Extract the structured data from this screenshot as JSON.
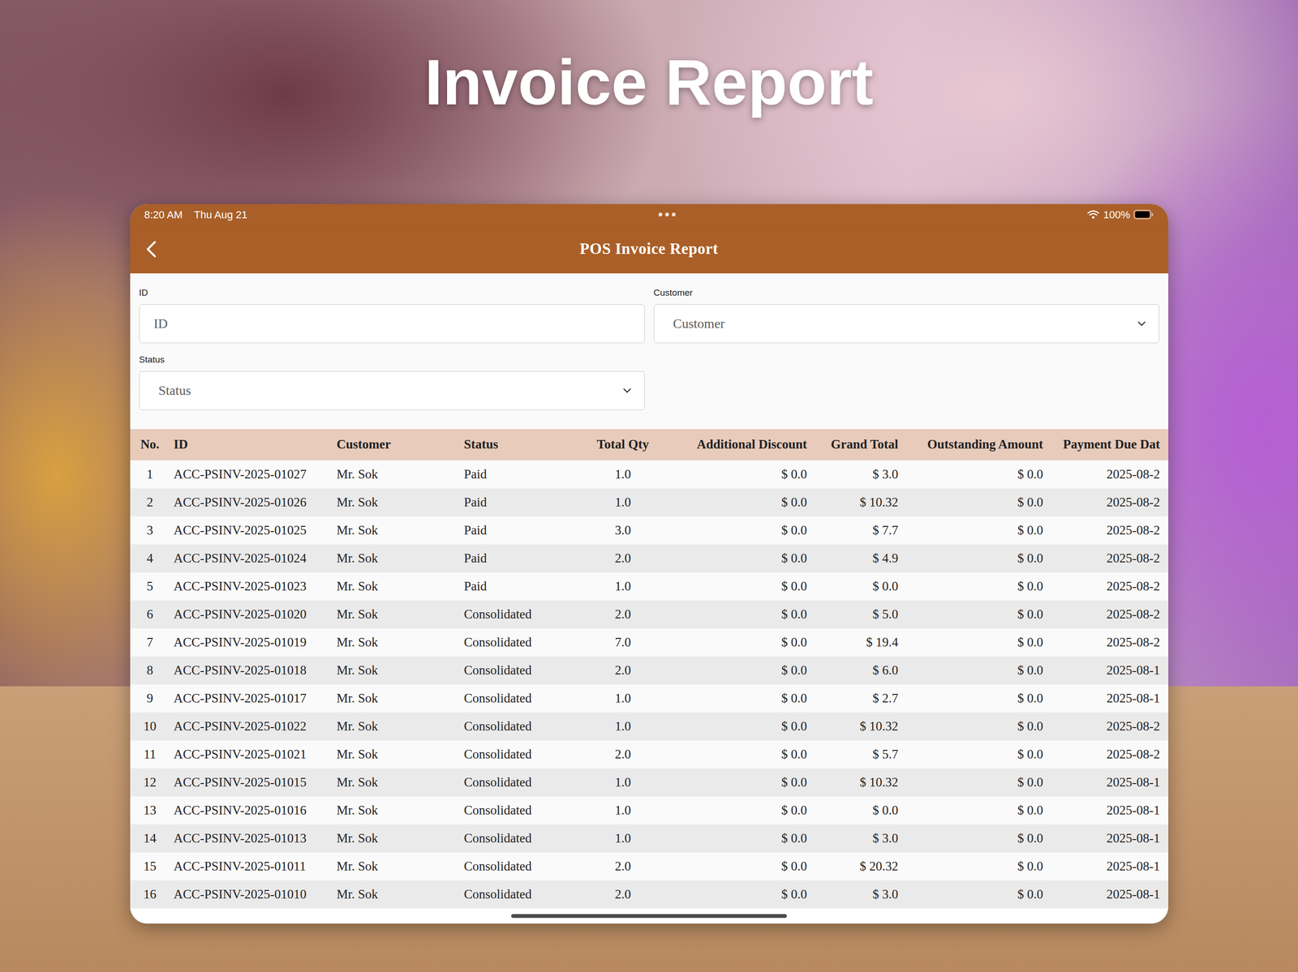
{
  "page": {
    "title": "Invoice Report"
  },
  "status_bar": {
    "time": "8:20 AM",
    "date": "Thu Aug 21",
    "battery": "100%",
    "battery_level": 1
  },
  "nav": {
    "title": "POS Invoice Report"
  },
  "filters": [
    {
      "label": "ID",
      "placeholder": "ID",
      "kind": "text"
    },
    {
      "label": "Customer",
      "placeholder": "Customer",
      "kind": "select"
    },
    {
      "label": "Status",
      "placeholder": "Status",
      "kind": "select"
    }
  ],
  "table": {
    "columns": [
      "No.",
      "ID",
      "Customer",
      "Status",
      "Total Qty",
      "Additional Discount",
      "Grand Total",
      "Outstanding Amount",
      "Payment Due Dat"
    ],
    "rows": [
      [
        "1",
        "ACC-PSINV-2025-01027",
        "Mr. Sok",
        "Paid",
        "1.0",
        "$ 0.0",
        "$ 3.0",
        "$ 0.0",
        "2025-08-2"
      ],
      [
        "2",
        "ACC-PSINV-2025-01026",
        "Mr. Sok",
        "Paid",
        "1.0",
        "$ 0.0",
        "$ 10.32",
        "$ 0.0",
        "2025-08-2"
      ],
      [
        "3",
        "ACC-PSINV-2025-01025",
        "Mr. Sok",
        "Paid",
        "3.0",
        "$ 0.0",
        "$ 7.7",
        "$ 0.0",
        "2025-08-2"
      ],
      [
        "4",
        "ACC-PSINV-2025-01024",
        "Mr. Sok",
        "Paid",
        "2.0",
        "$ 0.0",
        "$ 4.9",
        "$ 0.0",
        "2025-08-2"
      ],
      [
        "5",
        "ACC-PSINV-2025-01023",
        "Mr. Sok",
        "Paid",
        "1.0",
        "$ 0.0",
        "$ 0.0",
        "$ 0.0",
        "2025-08-2"
      ],
      [
        "6",
        "ACC-PSINV-2025-01020",
        "Mr. Sok",
        "Consolidated",
        "2.0",
        "$ 0.0",
        "$ 5.0",
        "$ 0.0",
        "2025-08-2"
      ],
      [
        "7",
        "ACC-PSINV-2025-01019",
        "Mr. Sok",
        "Consolidated",
        "7.0",
        "$ 0.0",
        "$ 19.4",
        "$ 0.0",
        "2025-08-2"
      ],
      [
        "8",
        "ACC-PSINV-2025-01018",
        "Mr. Sok",
        "Consolidated",
        "2.0",
        "$ 0.0",
        "$ 6.0",
        "$ 0.0",
        "2025-08-1"
      ],
      [
        "9",
        "ACC-PSINV-2025-01017",
        "Mr. Sok",
        "Consolidated",
        "1.0",
        "$ 0.0",
        "$ 2.7",
        "$ 0.0",
        "2025-08-1"
      ],
      [
        "10",
        "ACC-PSINV-2025-01022",
        "Mr. Sok",
        "Consolidated",
        "1.0",
        "$ 0.0",
        "$ 10.32",
        "$ 0.0",
        "2025-08-2"
      ],
      [
        "11",
        "ACC-PSINV-2025-01021",
        "Mr. Sok",
        "Consolidated",
        "2.0",
        "$ 0.0",
        "$ 5.7",
        "$ 0.0",
        "2025-08-2"
      ],
      [
        "12",
        "ACC-PSINV-2025-01015",
        "Mr. Sok",
        "Consolidated",
        "1.0",
        "$ 0.0",
        "$ 10.32",
        "$ 0.0",
        "2025-08-1"
      ],
      [
        "13",
        "ACC-PSINV-2025-01016",
        "Mr. Sok",
        "Consolidated",
        "1.0",
        "$ 0.0",
        "$ 0.0",
        "$ 0.0",
        "2025-08-1"
      ],
      [
        "14",
        "ACC-PSINV-2025-01013",
        "Mr. Sok",
        "Consolidated",
        "1.0",
        "$ 0.0",
        "$ 3.0",
        "$ 0.0",
        "2025-08-1"
      ],
      [
        "15",
        "ACC-PSINV-2025-01011",
        "Mr. Sok",
        "Consolidated",
        "2.0",
        "$ 0.0",
        "$ 20.32",
        "$ 0.0",
        "2025-08-1"
      ],
      [
        "16",
        "ACC-PSINV-2025-01010",
        "Mr. Sok",
        "Consolidated",
        "2.0",
        "$ 0.0",
        "$ 3.0",
        "$ 0.0",
        "2025-08-1"
      ]
    ]
  }
}
